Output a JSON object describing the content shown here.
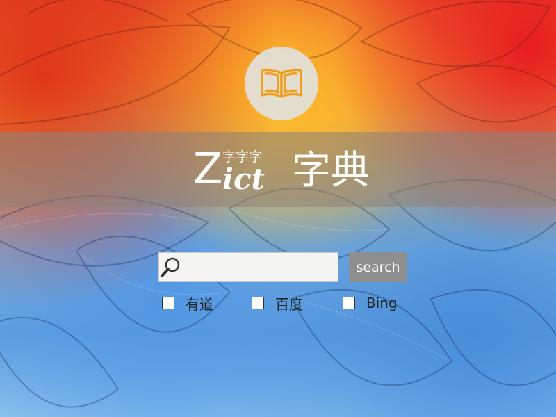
{
  "logo": {
    "icon": "book-icon"
  },
  "brand": {
    "z": "Z",
    "small": "字字字",
    "ict": "ict",
    "big": "字典"
  },
  "search": {
    "icon": "search-icon",
    "value": "",
    "placeholder": "",
    "button_label": "search"
  },
  "engines": [
    {
      "label": "有道",
      "checked": false
    },
    {
      "label": "百度",
      "checked": false
    },
    {
      "label": "Bing",
      "checked": false
    }
  ],
  "colors": {
    "band": "#8c8278",
    "button": "#8e8e8e",
    "logo_circle": "#e1e1dc",
    "book_icon": "#f0a020"
  }
}
